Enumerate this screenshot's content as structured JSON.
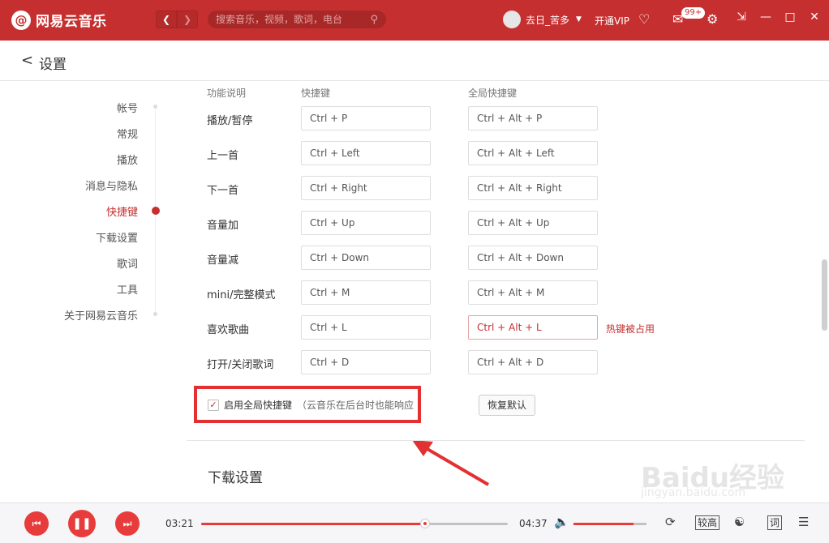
{
  "app": {
    "title": "网易云音乐",
    "logo_glyph": "@"
  },
  "titlebar": {
    "search_placeholder": "搜索音乐，视频，歌词，电台",
    "username": "去日_苦多",
    "vip_label": "开通VIP",
    "mail_badge": "99+",
    "accent": "#c62f2f"
  },
  "page": {
    "title": "设置",
    "back_icon": "<"
  },
  "sidenav": {
    "items": [
      {
        "label": "帐号"
      },
      {
        "label": "常规"
      },
      {
        "label": "播放"
      },
      {
        "label": "消息与隐私"
      },
      {
        "label": "快捷键"
      },
      {
        "label": "下载设置"
      },
      {
        "label": "歌词"
      },
      {
        "label": "工具"
      },
      {
        "label": "关于网易云音乐"
      }
    ],
    "active_index": 4
  },
  "shortcuts": {
    "headers": {
      "function": "功能说明",
      "shortcut": "快捷键",
      "global": "全局快捷键"
    },
    "rows": [
      {
        "name": "播放/暂停",
        "key": "Ctrl + P",
        "global": "Ctrl + Alt + P"
      },
      {
        "name": "上一首",
        "key": "Ctrl + Left",
        "global": "Ctrl + Alt + Left"
      },
      {
        "name": "下一首",
        "key": "Ctrl + Right",
        "global": "Ctrl + Alt + Right"
      },
      {
        "name": "音量加",
        "key": "Ctrl + Up",
        "global": "Ctrl + Alt + Up"
      },
      {
        "name": "音量减",
        "key": "Ctrl + Down",
        "global": "Ctrl + Alt + Down"
      },
      {
        "name": "mini/完整模式",
        "key": "Ctrl + M",
        "global": "Ctrl + Alt + M"
      },
      {
        "name": "喜欢歌曲",
        "key": "Ctrl + L",
        "global": "Ctrl + Alt + L",
        "conflict": "热键被占用"
      },
      {
        "name": "打开/关闭歌词",
        "key": "Ctrl + D",
        "global": "Ctrl + Alt + D"
      }
    ],
    "enable_global_label": "启用全局快捷键",
    "enable_global_note": "（云音乐在后台时也能响应",
    "enable_global_checked": true,
    "restore_label": "恢复默认"
  },
  "next_section_title": "下载设置",
  "player": {
    "current_time": "03:21",
    "total_time": "04:37",
    "progress": 0.73,
    "volume": 0.82,
    "quality_label": "较高",
    "lyrics_label": "词"
  },
  "watermark": {
    "text": "Baidu经验",
    "sub": "jingyan.baidu.com"
  }
}
